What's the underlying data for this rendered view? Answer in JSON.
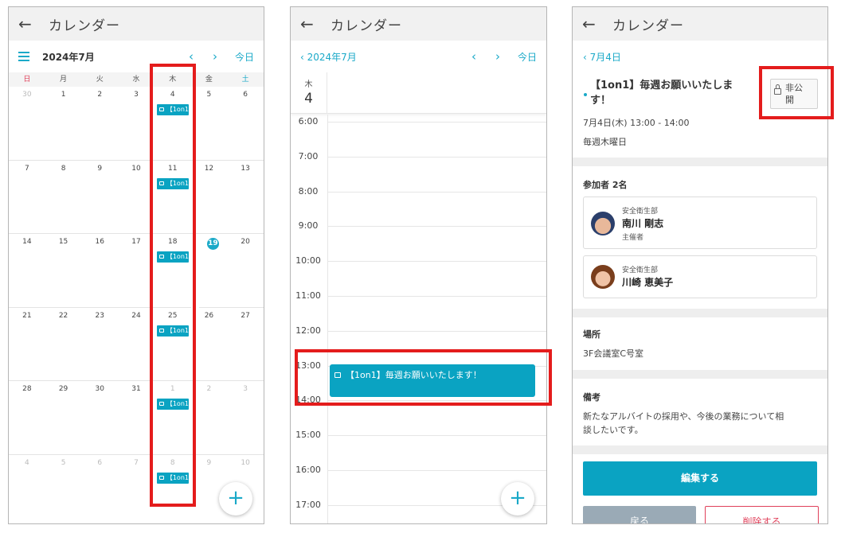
{
  "common": {
    "back_glyph": "←",
    "app_title": "カレンダー"
  },
  "month_view": {
    "month": "2024年7月",
    "prev": "‹",
    "next": "›",
    "today": "今日",
    "weekdays": [
      "日",
      "月",
      "火",
      "水",
      "木",
      "金",
      "土"
    ],
    "days": [
      [
        "30",
        "1",
        "2",
        "3",
        "4",
        "5",
        "6"
      ],
      [
        "7",
        "8",
        "9",
        "10",
        "11",
        "12",
        "13"
      ],
      [
        "14",
        "15",
        "16",
        "17",
        "18",
        "19",
        "20"
      ],
      [
        "21",
        "22",
        "23",
        "24",
        "25",
        "26",
        "27"
      ],
      [
        "28",
        "29",
        "30",
        "31",
        "1",
        "2",
        "3"
      ],
      [
        "4",
        "5",
        "6",
        "7",
        "8",
        "9",
        "10"
      ]
    ],
    "event_label": "【1on1",
    "fab": "+",
    "lock_glyph": "🔒"
  },
  "day_view": {
    "back_month": "‹ 2024年7月",
    "prev": "‹",
    "next": "›",
    "today": "今日",
    "weekday": "木",
    "date": "4",
    "hours": [
      "6:00",
      "7:00",
      "8:00",
      "9:00",
      "10:00",
      "11:00",
      "12:00",
      "13:00",
      "14:00",
      "15:00",
      "16:00",
      "17:00"
    ],
    "event": "【1on1】毎週お願いいたします！",
    "fab": "+"
  },
  "detail_view": {
    "back_day": "‹ 7月4日",
    "title_line1": "【1on1】毎週お願いいたしま",
    "title_line2": "す！",
    "visibility_line1": "非公",
    "visibility_line2": "開",
    "datetime": "7月4日(木) 13:00 - 14:00",
    "recurrence": "毎週木曜日",
    "participants_label": "参加者 2名",
    "participants": [
      {
        "dept": "安全衛生部",
        "name": "南川 剛志",
        "role": "主催者"
      },
      {
        "dept": "安全衛生部",
        "name": "川崎 恵美子",
        "role": ""
      }
    ],
    "place_label": "場所",
    "place": "3F会議室C号室",
    "note_label": "備考",
    "note_line1": "新たなアルバイトの採用や、今後の業務について相",
    "note_line2": "談したいです。",
    "edit_button": "編集する",
    "back_button": "戻る",
    "delete_button": "削除する"
  },
  "colors": {
    "accent": "#0aa3c2",
    "highlight": "#e41c1c",
    "sunday": "#e0405a"
  }
}
